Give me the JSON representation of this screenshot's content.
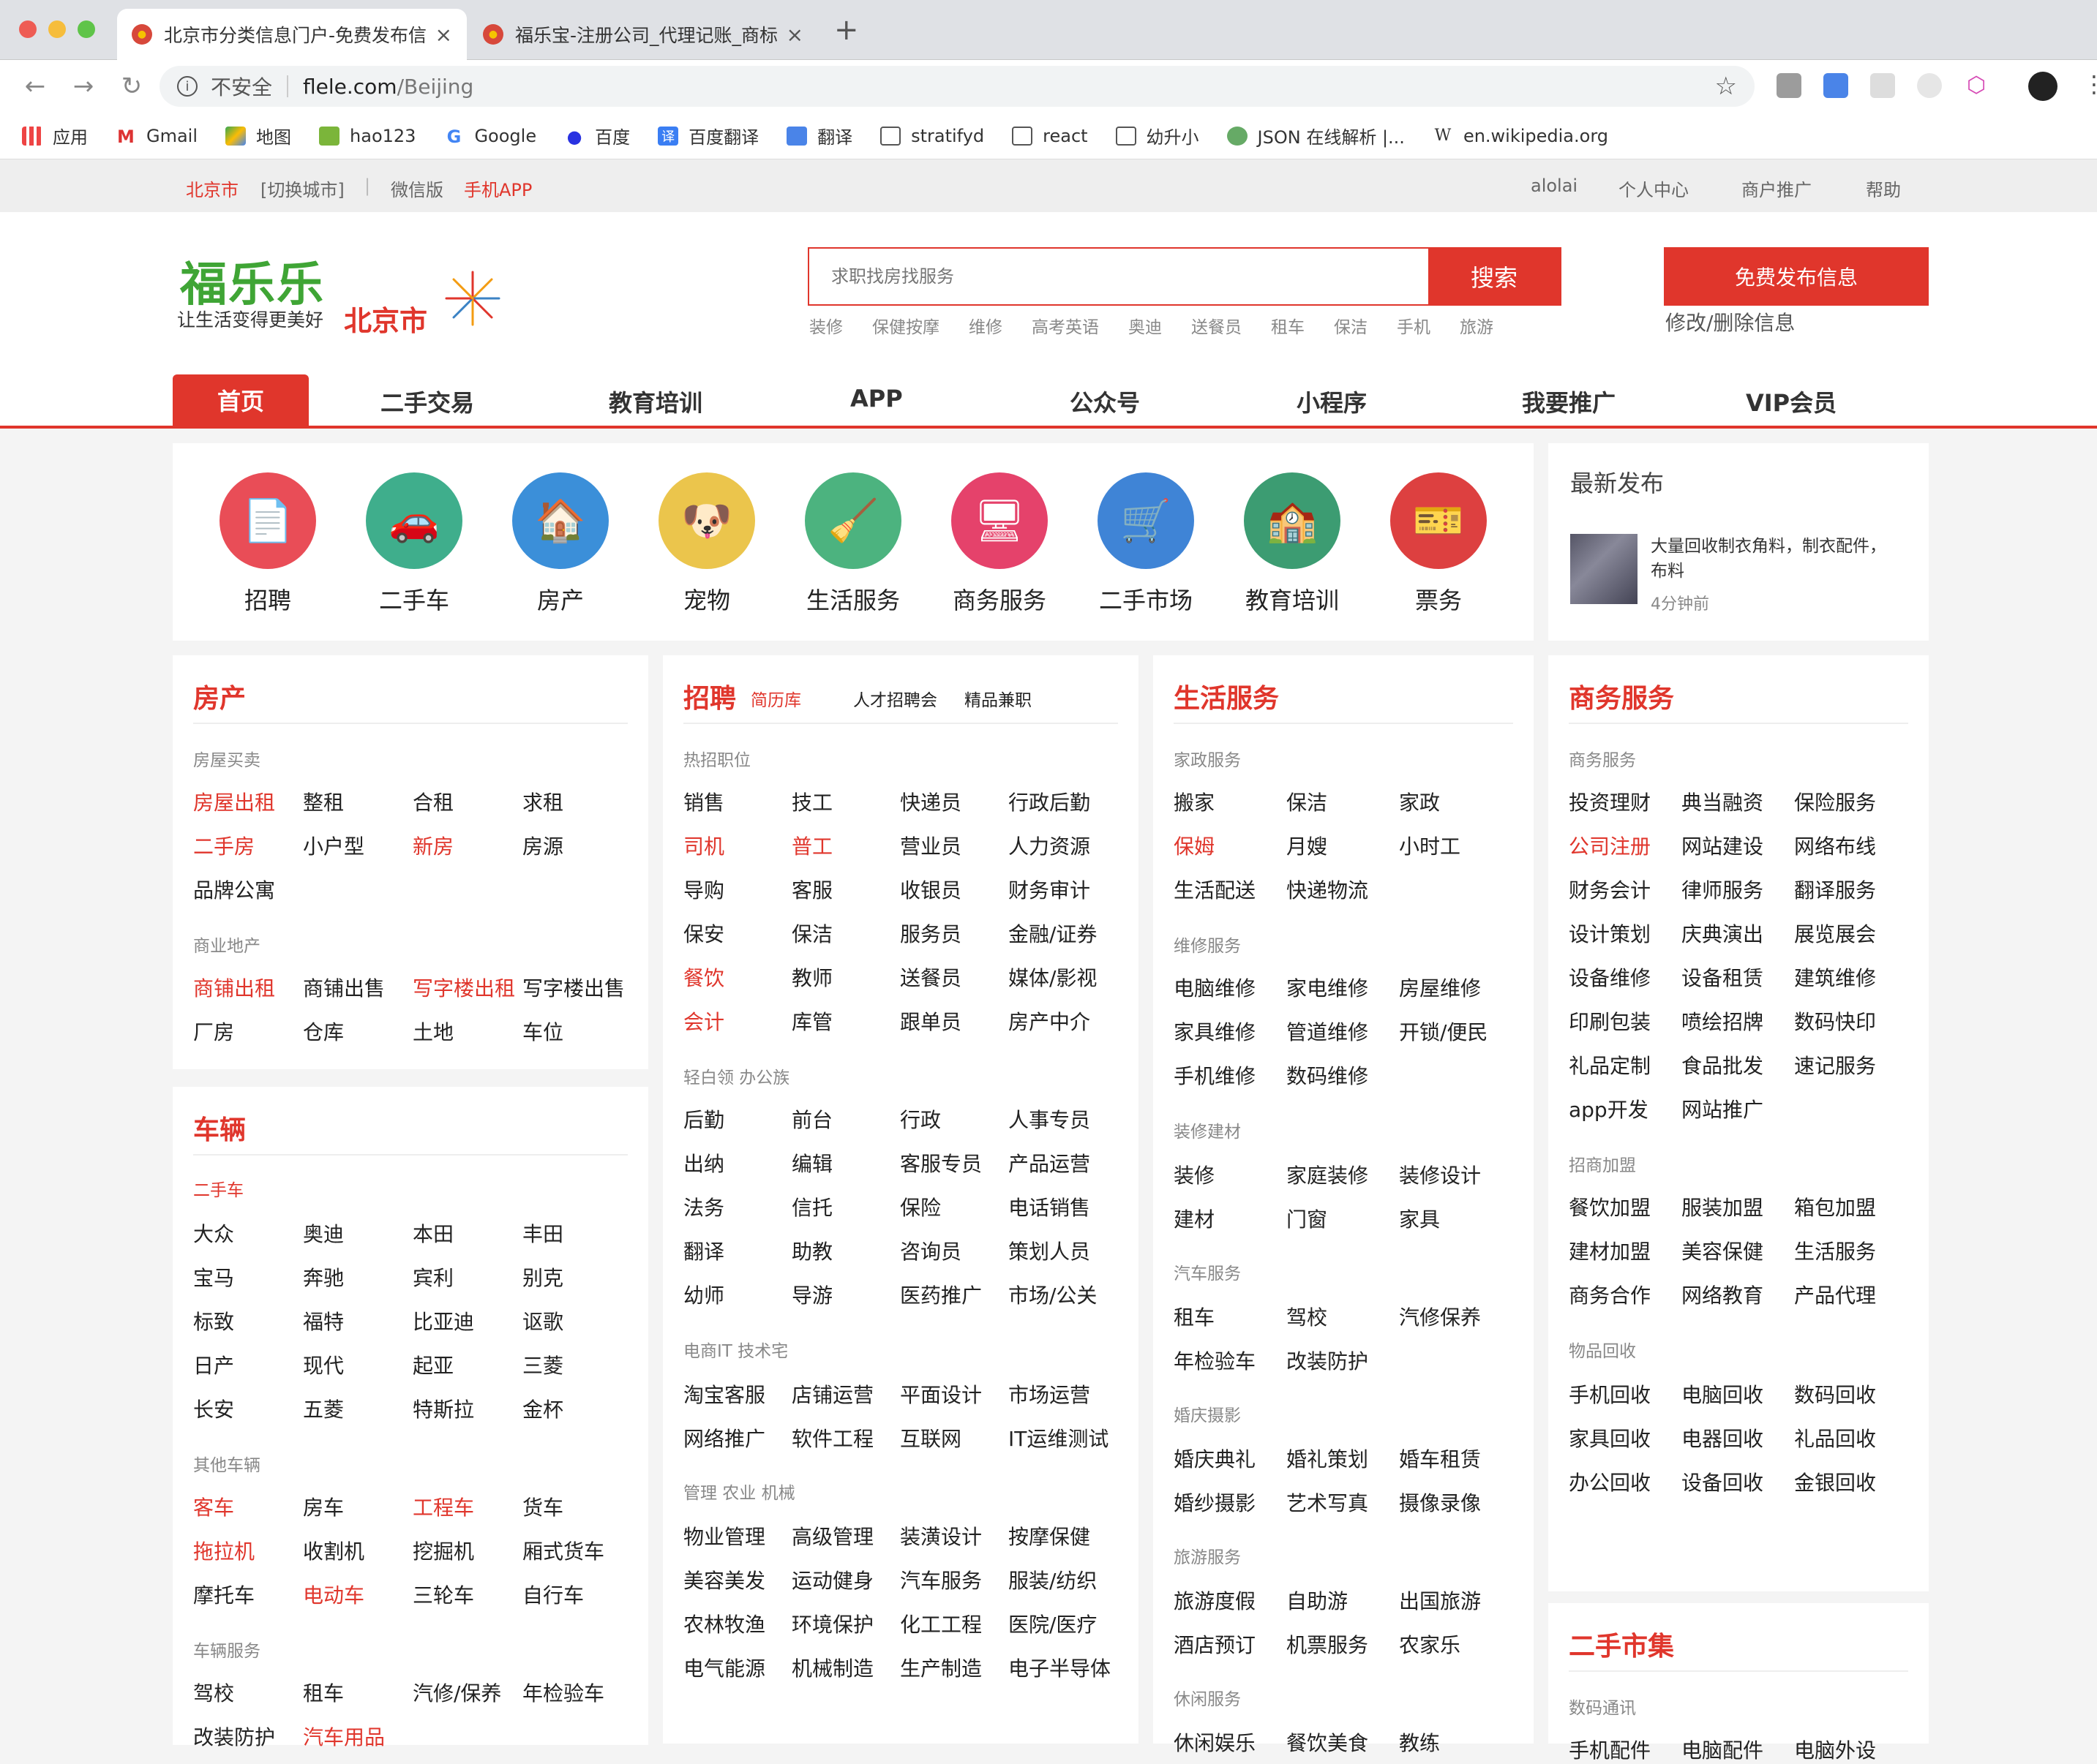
{
  "browser": {
    "tabs": [
      {
        "title": "北京市分类信息门户-免费发布信息"
      },
      {
        "title": "福乐宝-注册公司_代理记账_商标"
      }
    ],
    "new_tab": "+",
    "security": "不安全",
    "url_domain": "flele.com",
    "url_path": "/Beijing",
    "bookmarks": [
      {
        "label": "应用"
      },
      {
        "label": "Gmail"
      },
      {
        "label": "地图"
      },
      {
        "label": "hao123"
      },
      {
        "label": "Google"
      },
      {
        "label": "百度"
      },
      {
        "label": "百度翻译"
      },
      {
        "label": "翻译"
      },
      {
        "label": "stratifyd"
      },
      {
        "label": "react"
      },
      {
        "label": "幼升小"
      },
      {
        "label": "JSON 在线解析 |..."
      },
      {
        "label": "en.wikipedia.org"
      }
    ]
  },
  "topbar": {
    "city": "北京市",
    "switch": "[切换城市]",
    "divider": "|",
    "wechat": "微信版",
    "app": "手机APP",
    "user": "alolai",
    "center": "个人中心",
    "promo": "商户推广",
    "help": "帮助"
  },
  "header": {
    "logo": "福乐乐",
    "slogan": "让生活变得更美好",
    "city": "北京市",
    "search_placeholder": "求职找房找服务",
    "search_button": "搜索",
    "hot": [
      "装修",
      "保健按摩",
      "维修",
      "高考英语",
      "奥迪",
      "送餐员",
      "租车",
      "保洁",
      "手机",
      "旅游"
    ],
    "publish": "免费发布信息",
    "modify": "修改/删除信息"
  },
  "nav": [
    "首页",
    "二手交易",
    "教育培训",
    "APP",
    "公众号",
    "小程序",
    "我要推广",
    "VIP会员"
  ],
  "categories": [
    "招聘",
    "二手车",
    "房产",
    "宠物",
    "生活服务",
    "商务服务",
    "二手市场",
    "教育培训",
    "票务"
  ],
  "latest": {
    "title": "最新发布",
    "text": "大量回收制衣角料，制衣配件，布料",
    "time": "4分钟前"
  },
  "fangchan": {
    "title": "房产",
    "sub1": "房屋买卖",
    "row1": [
      "房屋出租",
      "整租",
      "合租",
      "求租"
    ],
    "row2": [
      "二手房",
      "小户型",
      "新房",
      "房源"
    ],
    "row3": [
      "品牌公寓"
    ],
    "sub2": "商业地产",
    "row4": [
      "商铺出租",
      "商铺出售",
      "写字楼出租",
      "写字楼出售"
    ],
    "row5": [
      "厂房",
      "仓库",
      "土地",
      "车位"
    ]
  },
  "cheliang": {
    "title": "车辆",
    "sub1": "二手车",
    "r1": [
      "大众",
      "奥迪",
      "本田",
      "丰田"
    ],
    "r2": [
      "宝马",
      "奔驰",
      "宾利",
      "别克"
    ],
    "r3": [
      "标致",
      "福特",
      "比亚迪",
      "讴歌"
    ],
    "r4": [
      "日产",
      "现代",
      "起亚",
      "三菱"
    ],
    "r5": [
      "长安",
      "五菱",
      "特斯拉",
      "金杯"
    ],
    "sub2": "其他车辆",
    "r6": [
      "客车",
      "房车",
      "工程车",
      "货车"
    ],
    "r7": [
      "拖拉机",
      "收割机",
      "挖掘机",
      "厢式货车"
    ],
    "r8": [
      "摩托车",
      "电动车",
      "三轮车",
      "自行车"
    ],
    "sub3": "车辆服务",
    "r9": [
      "驾校",
      "租车",
      "汽修/保养",
      "年检验车"
    ],
    "r10": [
      "改装防护",
      "汽车用品"
    ]
  },
  "zhaopin": {
    "title": "招聘",
    "resume": "简历库",
    "fair": "人才招聘会",
    "parttime": "精品兼职",
    "sub1": "热招职位",
    "r1": [
      "销售",
      "技工",
      "快递员",
      "行政后勤"
    ],
    "r2": [
      "司机",
      "普工",
      "营业员",
      "人力资源"
    ],
    "r3": [
      "导购",
      "客服",
      "收银员",
      "财务审计"
    ],
    "r4": [
      "保安",
      "保洁",
      "服务员",
      "金融/证券"
    ],
    "r5": [
      "餐饮",
      "教师",
      "送餐员",
      "媒体/影视"
    ],
    "r6": [
      "会计",
      "库管",
      "跟单员",
      "房产中介"
    ],
    "sub2": "轻白领 办公族",
    "r7": [
      "后勤",
      "前台",
      "行政",
      "人事专员"
    ],
    "r8": [
      "出纳",
      "编辑",
      "客服专员",
      "产品运营"
    ],
    "r9": [
      "法务",
      "信托",
      "保险",
      "电话销售"
    ],
    "r10": [
      "翻译",
      "助教",
      "咨询员",
      "策划人员"
    ],
    "r11": [
      "幼师",
      "导游",
      "医药推广",
      "市场/公关"
    ],
    "sub3": "电商IT 技术宅",
    "r12": [
      "淘宝客服",
      "店铺运营",
      "平面设计",
      "市场运营"
    ],
    "r13": [
      "网络推广",
      "软件工程",
      "互联网",
      "IT运维测试"
    ],
    "sub4": "管理 农业 机械",
    "r14": [
      "物业管理",
      "高级管理",
      "装潢设计",
      "按摩保健"
    ],
    "r15": [
      "美容美发",
      "运动健身",
      "汽车服务",
      "服装/纺织"
    ],
    "r16": [
      "农林牧渔",
      "环境保护",
      "化工工程",
      "医院/医疗"
    ],
    "r17": [
      "电气能源",
      "机械制造",
      "生产制造",
      "电子半导体"
    ]
  },
  "shenghuo": {
    "title": "生活服务",
    "sub1": "家政服务",
    "r1": [
      "搬家",
      "保洁",
      "家政"
    ],
    "r2": [
      "保姆",
      "月嫂",
      "小时工"
    ],
    "r3": [
      "生活配送",
      "快递物流"
    ],
    "sub2": "维修服务",
    "r4": [
      "电脑维修",
      "家电维修",
      "房屋维修"
    ],
    "r5": [
      "家具维修",
      "管道维修",
      "开锁/便民"
    ],
    "r6": [
      "手机维修",
      "数码维修"
    ],
    "sub3": "装修建材",
    "r7": [
      "装修",
      "家庭装修",
      "装修设计"
    ],
    "r8": [
      "建材",
      "门窗",
      "家具"
    ],
    "sub4": "汽车服务",
    "r9": [
      "租车",
      "驾校",
      "汽修保养"
    ],
    "r10": [
      "年检验车",
      "改装防护"
    ],
    "sub5": "婚庆摄影",
    "r11": [
      "婚庆典礼",
      "婚礼策划",
      "婚车租赁"
    ],
    "r12": [
      "婚纱摄影",
      "艺术写真",
      "摄像录像"
    ],
    "sub6": "旅游服务",
    "r13": [
      "旅游度假",
      "自助游",
      "出国旅游"
    ],
    "r14": [
      "酒店预订",
      "机票服务",
      "农家乐"
    ],
    "sub7": "休闲服务",
    "r15": [
      "休闲娱乐",
      "餐饮美食",
      "教练"
    ]
  },
  "shangwu": {
    "title": "商务服务",
    "sub1": "商务服务",
    "r1": [
      "投资理财",
      "典当融资",
      "保险服务"
    ],
    "r2": [
      "公司注册",
      "网站建设",
      "网络布线"
    ],
    "r3": [
      "财务会计",
      "律师服务",
      "翻译服务"
    ],
    "r4": [
      "设计策划",
      "庆典演出",
      "展览展会"
    ],
    "r5": [
      "设备维修",
      "设备租赁",
      "建筑维修"
    ],
    "r6": [
      "印刷包装",
      "喷绘招牌",
      "数码快印"
    ],
    "r7": [
      "礼品定制",
      "食品批发",
      "速记服务"
    ],
    "r8": [
      "app开发",
      "网站推广"
    ],
    "sub2": "招商加盟",
    "r9": [
      "餐饮加盟",
      "服装加盟",
      "箱包加盟"
    ],
    "r10": [
      "建材加盟",
      "美容保健",
      "生活服务"
    ],
    "r11": [
      "商务合作",
      "网络教育",
      "产品代理"
    ],
    "sub3": "物品回收",
    "r12": [
      "手机回收",
      "电脑回收",
      "数码回收"
    ],
    "r13": [
      "家具回收",
      "电器回收",
      "礼品回收"
    ],
    "r14": [
      "办公回收",
      "设备回收",
      "金银回收"
    ]
  },
  "ershou": {
    "title": "二手市集",
    "sub1": "数码通讯",
    "r1": [
      "手机配件",
      "电脑配件",
      "电脑外设"
    ]
  }
}
